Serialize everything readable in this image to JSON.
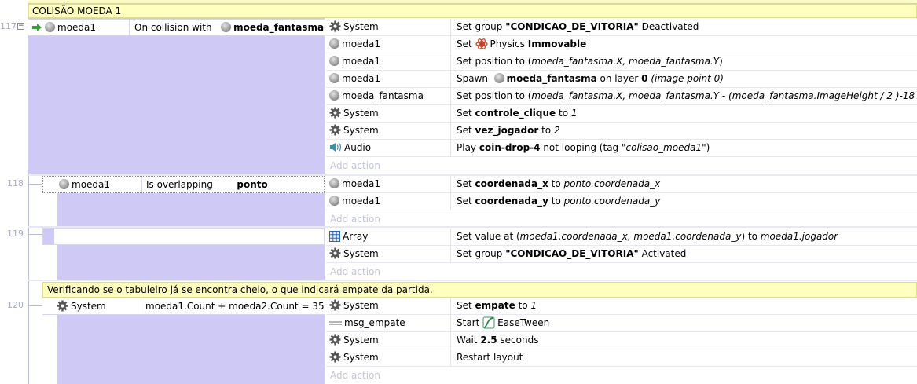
{
  "group": {
    "title": "COLISÃO MOEDA 1"
  },
  "events": [
    {
      "line": "117",
      "conditions": [
        {
          "object": "moeda1",
          "condition": "On collision with",
          "param": "moeda_fantasma"
        }
      ],
      "actions": [
        {
          "object": "System",
          "icon": "gear-icon",
          "parts": [
            "Set group ",
            "\"CONDICAO_DE_VITORIA\"",
            " Deactivated"
          ]
        },
        {
          "object": "moeda1",
          "icon": "sprite-icon",
          "parts": [
            "Set ",
            "Physics ",
            "Immovable"
          ]
        },
        {
          "object": "moeda1",
          "icon": "sprite-icon",
          "parts": [
            "Set position to (",
            "moeda_fantasma.X, moeda_fantasma.Y",
            ")"
          ]
        },
        {
          "object": "moeda1",
          "icon": "sprite-icon",
          "parts": [
            "Spawn ",
            "moeda_fantasma",
            " on layer ",
            "0",
            " (image point 0)"
          ]
        },
        {
          "object": "moeda_fantasma",
          "icon": "sprite-icon",
          "parts": [
            "Set position to (",
            "moeda_fantasma.X, moeda_fantasma.Y - (moeda_fantasma.ImageHeight / 2 )-18",
            "   )"
          ]
        },
        {
          "object": "System",
          "icon": "gear-icon",
          "parts": [
            "Set ",
            "controle_clique",
            " to ",
            "1"
          ]
        },
        {
          "object": "System",
          "icon": "gear-icon",
          "parts": [
            "Set ",
            "vez_jogador",
            " to ",
            "2"
          ]
        },
        {
          "object": "Audio",
          "icon": "speaker-icon",
          "parts": [
            "Play ",
            "coin-drop-4",
            " not looping (tag ",
            "\"colisao_moeda1\"",
            ")"
          ]
        }
      ]
    },
    {
      "line": "118",
      "conditions": [
        {
          "object": "moeda1",
          "condition": "Is overlapping",
          "param": "ponto"
        }
      ],
      "actions": [
        {
          "object": "moeda1",
          "icon": "sprite-icon",
          "parts": [
            "Set ",
            "coordenada_x",
            " to ",
            "ponto.coordenada_x"
          ]
        },
        {
          "object": "moeda1",
          "icon": "sprite-icon",
          "parts": [
            "Set ",
            "coordenada_y",
            " to ",
            "ponto.coordenada_y"
          ]
        }
      ]
    },
    {
      "line": "119",
      "conditions": [],
      "actions": [
        {
          "object": "Array",
          "icon": "grid-icon",
          "parts": [
            "Set value at (",
            "moeda1.coordenada_x, moeda1.coordenada_y",
            ") to ",
            "moeda1.jogador"
          ]
        },
        {
          "object": "System",
          "icon": "gear-icon",
          "parts": [
            "Set group ",
            "\"CONDICAO_DE_VITORIA\"",
            " Activated"
          ]
        }
      ]
    },
    {
      "line": "120",
      "comment": "Verificando se o tabuleiro já se encontra cheio, o que indicará empate da partida.",
      "conditions": [
        {
          "object": "System",
          "condition": "moeda1.Count + moeda2.Count = 35"
        }
      ],
      "actions": [
        {
          "object": "System",
          "icon": "gear-icon",
          "parts": [
            "Set ",
            "empate",
            " to ",
            "1"
          ]
        },
        {
          "object": "msg_empate",
          "icon": "text-icon",
          "parts": [
            "Start ",
            "EaseTween"
          ]
        },
        {
          "object": "System",
          "icon": "gear-icon",
          "parts": [
            "Wait ",
            "2.5",
            " seconds"
          ]
        },
        {
          "object": "System",
          "icon": "gear-icon",
          "parts": [
            "Restart layout"
          ]
        }
      ]
    }
  ],
  "add_action_label": "Add action"
}
